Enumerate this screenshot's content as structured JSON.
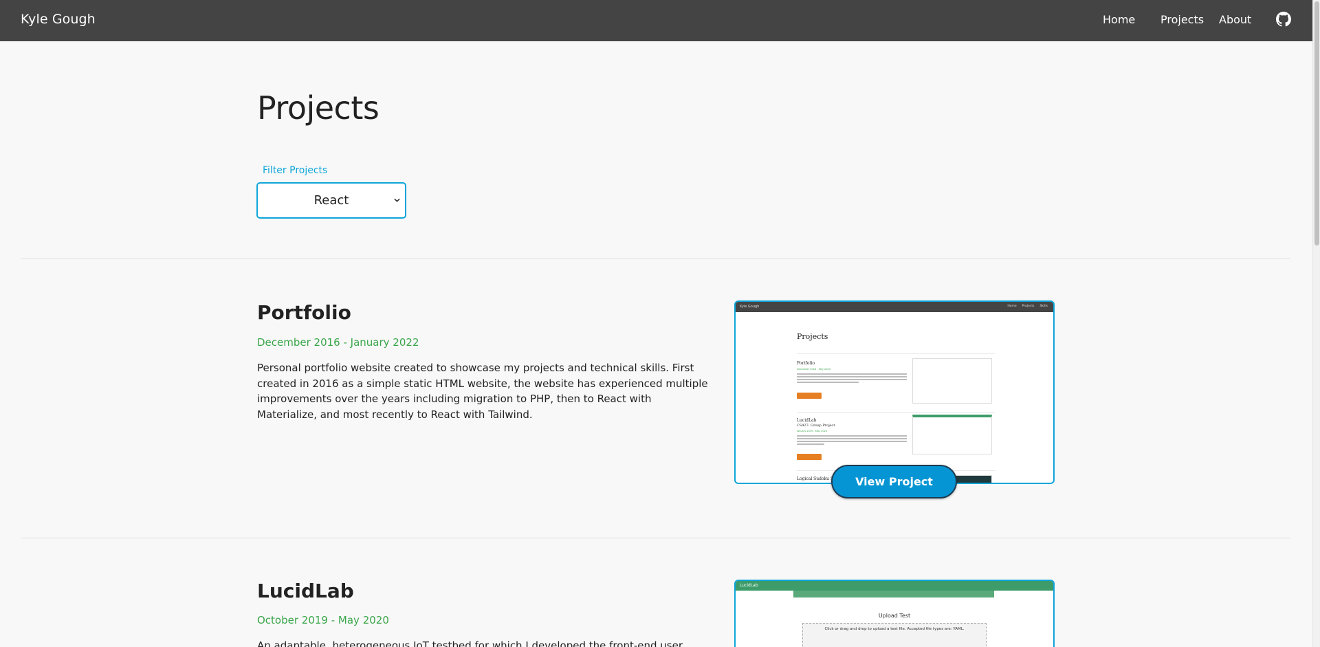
{
  "nav": {
    "brand": "Kyle Gough",
    "links": [
      "Home",
      "Projects",
      "About"
    ]
  },
  "page": {
    "title": "Projects",
    "filter_label": "Filter Projects",
    "filter_value": "React"
  },
  "projects": [
    {
      "title": "Portfolio",
      "date": "December 2016 - January 2022",
      "description": "Personal portfolio website created to showcase my projects and technical skills. First created in 2016 as a simple static HTML website, the website has experienced multiple improvements over the years including migration to PHP, then to React with Materialize, and most recently to React with Tailwind.",
      "button": "View Project",
      "preview": {
        "brand": "Kyle Gough",
        "links": [
          "Home",
          "Projects",
          "Skills"
        ],
        "heading": "Projects",
        "items": [
          {
            "title": "Portfolio",
            "date": "December 2016 - May 2020"
          },
          {
            "title": "LucidLab",
            "subtitle": "CS427: Group Project",
            "date": "January 2019 - May 2020"
          },
          {
            "title": "Logical Sudoku Sol"
          }
        ]
      }
    },
    {
      "title": "LucidLab",
      "date": "October 2019 - May 2020",
      "description": "An adaptable, heterogeneous IoT testbed for which I developed the front-end user interface. The UI",
      "preview": {
        "brand": "LucidLab",
        "heading": "Upload Test",
        "drop_text": "Click or drag and drop to upload a test file. Accepted file types are: YAML."
      }
    }
  ],
  "colors": {
    "navbar": "#444444",
    "accent": "#0ea5d9",
    "date": "#3aa64a",
    "button": "#0595d4"
  }
}
